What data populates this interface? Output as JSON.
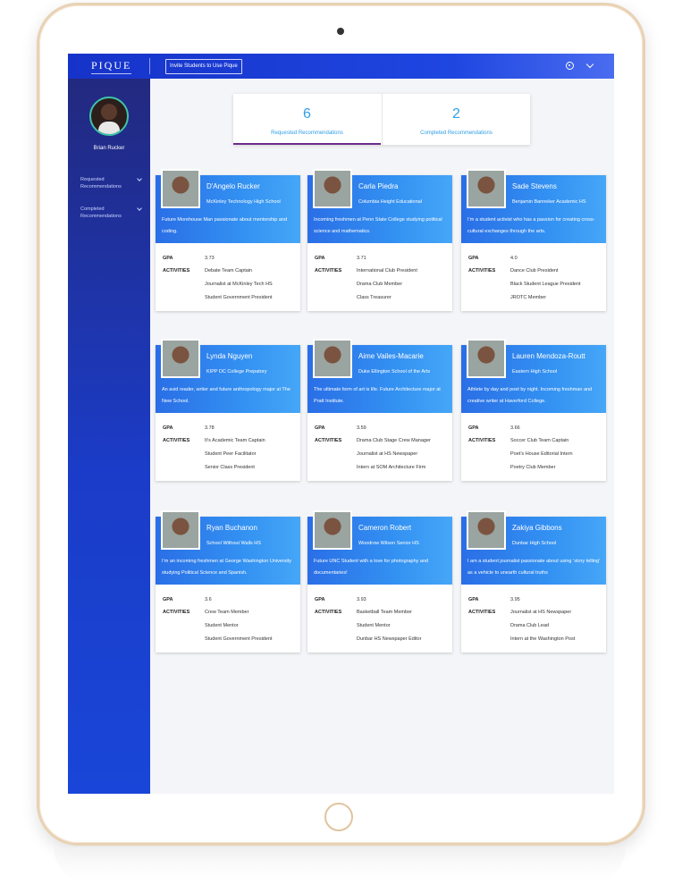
{
  "app": {
    "logo": "PIQUE",
    "invite_label": "Invite Students to Use Pique"
  },
  "icons": [
    "settings-icon",
    "chevron-down-icon"
  ],
  "sidebar": {
    "user_name": "Brian Rucker",
    "items": [
      {
        "label": "Requested Recommendations"
      },
      {
        "label": "Completed Recommendations"
      }
    ]
  },
  "summary": {
    "requested": {
      "count": "6",
      "label": "Requested Recommendations"
    },
    "completed": {
      "count": "2",
      "label": "Completed Recommendations"
    }
  },
  "colors": {
    "accent": "#2e9fe5",
    "tab_underline": "#6d2b8c",
    "topbar": "#1e46e0"
  },
  "labels": {
    "gpa": "GPA",
    "activities": "ACTIVITIES"
  },
  "students": [
    {
      "name": "D'Angelo Rucker",
      "school": "McKinley Technology High School",
      "bio": "Future Morehouse Man passionate about mentorship and coding.",
      "gpa": "3.73",
      "activities": [
        "Debate Team Captain",
        "Journalist at McKinley Tech HS",
        "Student Government President"
      ]
    },
    {
      "name": "Carla Piedra",
      "school": "Columbia Height Educational",
      "bio": "Incoming freshmen at Penn State College studying political science and mathematics.",
      "gpa": "3.71",
      "activities": [
        "International Club President",
        "Drama Club Member",
        "Class Treasurer"
      ]
    },
    {
      "name": "Sade Stevens",
      "school": "Benjamin Banneker Academic HS",
      "bio": "I’m a student activist who has a passion for creating cross-cultural exchanges through the arts.",
      "gpa": "4.0",
      "activities": [
        "Dance Club President",
        "Black Student League President",
        "JROTC Member"
      ]
    },
    {
      "name": "Lynda Nguyen",
      "school": "KIPP DC College Prepatory",
      "bio": "An avid reader, writer and future anthropology major at The New School.",
      "gpa": "3.78",
      "activities": [
        "It’s Academic Team Captain",
        "Student Peer Facilitator",
        "Senior Class President"
      ]
    },
    {
      "name": "Aime Vailes-Macarie",
      "school": "Duke Ellington School of the Arts",
      "bio": "The ultimate form of art is life. Future Architecture major at Pratt Institute.",
      "gpa": "3.59",
      "activities": [
        "Drama Club Stage Crew Manager",
        "Journalist at HS Newspaper",
        "Intern at SOM Architecture Firm"
      ]
    },
    {
      "name": "Lauren Mendoza-Routt",
      "school": "Eastern High School",
      "bio": "Athlete by day and poet by night. Incoming freshman and creative writer at Haverford College.",
      "gpa": "3.66",
      "activities": [
        "Soccer Club Team Captain",
        "Poet’s House Editorial Intern",
        "Poetry Club Member"
      ]
    },
    {
      "name": "Ryan Buchanon",
      "school": "School Without Walls HS",
      "bio": "I’m an incoming freshmen at George Washington University studying Political Science and Spanish.",
      "gpa": "3.6",
      "activities": [
        "Crew Team Member",
        "Student Mentor",
        "Student Government President"
      ]
    },
    {
      "name": "Cameron Robert",
      "school": "Woodrow Wilson Senior HS",
      "bio": "Future UNC Student with a love for photography and documentaries!",
      "gpa": "3.93",
      "activities": [
        "Basketball Team Member",
        "Student Mentor",
        "Dunbar HS Newspaper Editor"
      ]
    },
    {
      "name": "Zakiya Gibbons",
      "school": "Dunbar High School",
      "bio": "I am a student journalist passionate about using ‘story telling’ as a vehicle to unearth cultural truths",
      "gpa": "3.95",
      "activities": [
        "Journalist at HS Newspaper",
        "Drama Club Lead",
        "Intern at the Washington Post"
      ]
    }
  ]
}
